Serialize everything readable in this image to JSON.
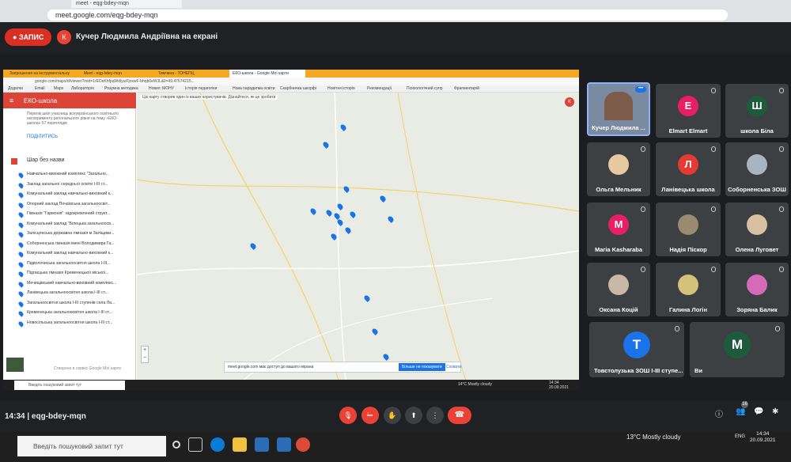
{
  "outer_browser": {
    "tab_title": "meet - eqg-bdey-mqn",
    "url": "meet.google.com/eqg-bdey-mqn"
  },
  "meet": {
    "record_label": "ЗАПИС",
    "presenter_initial": "К",
    "presenter_title": "Кучер Людмила Андріївна на екрані",
    "meeting_code": "14:34  |  eqg-bdey-mqn",
    "participant_count": "16"
  },
  "shared": {
    "tabs": [
      "Запрошення на інструментальну",
      "Meet - eqg-bdey-mqn",
      "Тимчина - ТОНЕПЦ",
      "ЕКО-школа - Google Мої карти"
    ],
    "url": "google.com/maps/d/viewer?mid=1rEDeKhfpqWdlyuiFjoxwF-bhqb0eWJL&ll=49.47574215...",
    "bookmarks": [
      "Додатки",
      "Email",
      "Maps",
      "Лабораторія",
      "Розумна методика",
      "Нових: МОНУ",
      "Історія педагогіки",
      "Нова парадигма освіти",
      "Скарбничка шкорфі",
      "Новітня історія",
      "Рекомендації",
      "Психологічний супр",
      "Фрагментарій"
    ],
    "panel_title": "ЕКО-школа",
    "panel_desc": "Перелік шкіл учасниць всеукраїнського освітнього експерименту регіонального рівня на тему «ЕКО-школа» 57 переглядів",
    "share_label": "ПОДІЛИТИСЬ",
    "layer_title": "Шар без назви",
    "items": [
      "Навчально-виховний комплекс \"Загально...",
      "Заклад загальної середньої освіти І-ІІІ ст...",
      "Комунальний заклад навчально-виховний к...",
      "Опорний заклад Почаївська загальноосвіт...",
      "Гімназія \"Гармонія\": відокремлений структ...",
      "Комунальний заклад \"Білецька загальноосв...",
      "Залісцянська державна гімназія м Заліщики...",
      "Соборненська гімназія імені Володимира Га...",
      "Комунальний заклад навчально-виховний к...",
      "Підволочиська загальноосвітня школа І-ІІІ...",
      "Підгаєцька гімназія Кременецької міської...",
      "Мечищівський навчально-виховний комплекс...",
      "Ланівецька загальноосвітня школа І-ІІІ ст...",
      "Загальноосвітня школа І-ІІІ ступенів села Ла...",
      "Кременецька загальноосвітня школа І-ІІІ ст...",
      "Новосільська загальноосвітня школа І-ІІІ ст..."
    ],
    "panel_footer": "Створено в сервісі Google Мої карти",
    "map_note": "Цю карту створив один із ваших користувачів. Дізнайтеся, як це зробити",
    "map_avatar": "К",
    "cookie_text": "meet.google.com має доступ до вашого екрана",
    "cookie_button": "Більше не показувати",
    "cookie_close": "Сховати",
    "taskbar_search": "Введіть пошуковий запит тут",
    "tray": "14°C  Mostly cloudy",
    "clock_time": "14:34",
    "clock_date": "20.09.2021"
  },
  "participants": [
    {
      "name": "Кучер Людмила ..."
    },
    {
      "name": "Elmart Elmart",
      "initial": "E",
      "color": "#e91e63"
    },
    {
      "name": "школа Біла",
      "initial": "Ш",
      "color": "#1e5b3c"
    },
    {
      "name": "Ольга Мельник"
    },
    {
      "name": "Ланівецька школа",
      "initial": "Л",
      "color": "#e53935"
    },
    {
      "name": "Соборненська ЗОШ"
    },
    {
      "name": "Maria Kasharaba",
      "initial": "M",
      "color": "#e91e63"
    },
    {
      "name": "Надія Піскор"
    },
    {
      "name": "Олена Луговет"
    },
    {
      "name": "Оксана Коцій"
    },
    {
      "name": "Галина Логін"
    },
    {
      "name": "Зоряна Балик"
    },
    {
      "name": "Товстолузька ЗОШ І-ІІІ ступе...",
      "initial": "T",
      "color": "#1a73e8"
    },
    {
      "name": "Ви",
      "initial": "M",
      "color": "#1e5b3c"
    }
  ],
  "windows": {
    "search_placeholder": "Введіть пошуковий запит тут",
    "weather": "13°C  Mostly cloudy",
    "lang": "ENG",
    "time": "14:34",
    "date": "20.09.2021"
  }
}
